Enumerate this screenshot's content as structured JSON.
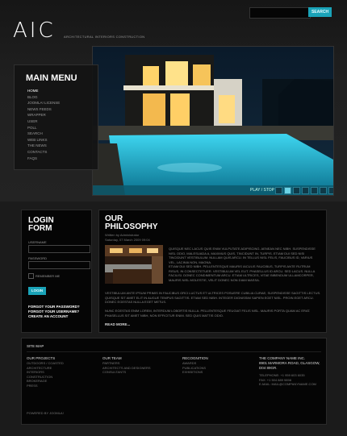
{
  "header": {
    "search_placeholder": "",
    "search_button": "SEARCH",
    "logo": "AIC",
    "logo_tagline": "ARCHITECTURAL INTERIORS CONSTRUCTION"
  },
  "main_menu": {
    "title": "MAIN MENU",
    "items": [
      "HOME",
      "BLOG",
      "JOOMLA! LICENSE",
      "NEWS FEEDS",
      "WRAPPER",
      "USER",
      "POLL",
      "SEARCH",
      "WEB LINKS",
      "THE NEWS",
      "CONTACTS",
      "FAQS"
    ]
  },
  "slider": {
    "play_label": "PLAY / STOP",
    "slide_count": 7,
    "active_slide": 2
  },
  "login": {
    "title_line1": "LOGIN",
    "title_line2": "FORM",
    "username_label": "USERNAME",
    "password_label": "PASSWORD",
    "remember_label": "REMEMBER ME",
    "login_button": "LOGIN",
    "forgot_password": "FORGOT YOUR PASSWORD?",
    "forgot_username": "FORGOT YOUR USERNAME?",
    "create_account": "CREATE AN ACCOUNT"
  },
  "philosophy": {
    "title_line1": "OUR",
    "title_line2": "PHILOSOPHY",
    "written_by": "Written by Administrator",
    "date": "Saturday, 07 March 2009 09:04",
    "para1": "QUISQUE NEC LACUS QUIS ENIM VULPUTATE ADIPISCING. AENEAN NEC NIBH. SUSPENDISSE NISL ODIO, MALESUADA A, MAXIMUS QUIS, TINCIDUNT IN, TURPIS. ETIAM DUI SED NISI TINCIDUNT VESTIBULUM. NULLAM QUIS ARCU. IN TELLUS NISL FELIS, FAUCIBUS ID, VARIUS VEL, LACINIA NON, MAGNA.",
    "para2": "ETIAM DUI SED NIBH. PELLENTESQUE MAURIS IACULIS FAUCIBUS, TURPIS ANTE RUTRUM RISUS, IN CONSECTETUER. VESTIBULUM VEL ELIT. PHASELLUS ID ARCU. SED LACUS. NULLA FACILISI. DONEC CONDIMENTUM ARCU. ETIAM ULTRICES, VITAE BIBENDUM ULLAMCORPER, MAURIS NISL MOLESTIE, VELIT DONEC NON DIAM MASSA.",
    "para3": "VESTIBULUM ANTE IPSUM PRIMIS IN FAUCIBUS ORCI LUCTUS ET ULTRICES POSUERE CUBILIA CURAE; SUSPENDISSE SAGITTIS LECTUS. QUISQUE SIT AMET ELIT IN AUGUE TEMPUS SAGITTIS. ETIAM SED NIBH. INTEGER DIGNISSIM SAPIEN EGET NISL. PROIN EGET ARCU. DONEC EGESTAS NULLA EGET METUS.",
    "para4": "NUNC EGESTAS ENIM LOREM, INTERDUM LOBORTIS NULLA. PELLENTESQUE FEUGIAT FELIS NISL. MAURIS PORTA QUAM AC ERAT. PHASELLUS SIT AMET NIBH, NON EFFICITUR ENIM. SED QUIS MATTIS ODIO.",
    "read_more": "READ MORE..."
  },
  "footer": {
    "title": "SITE MAP",
    "columns": [
      {
        "heading": "OUR PROJECTS",
        "items": [
          "OUTDOORS / COASTED",
          "ARCHITECTURE",
          "INTERIORS",
          "CONSTRUCTION",
          "BROKERAGE",
          "PRESS"
        ]
      },
      {
        "heading": "OUR TEAM",
        "items": [
          "PARTNERS",
          "ARCHITECTS AND DESIGNERS",
          "CONSULTANTS"
        ]
      },
      {
        "heading": "RECOGNITION",
        "items": [
          "AWARDS",
          "PUBLICATIONS",
          "EXHIBITIONS"
        ]
      }
    ],
    "company": "THE COMPANY NAME INC.",
    "address1": "8901 MARMORA ROAD, GLASGOW,",
    "address2": "D04 89GR.",
    "tel1": "TELEPHONE: +1 959 603 6035",
    "tel2": "FAX: +1 504 889 9898",
    "email": "E-MAIL: MAIL@COMPANYNAME.COM",
    "powered_by": "POWERED BY JOOMLA!"
  },
  "colors": {
    "accent": "#1aa3b8",
    "bg": "#1b1b1b",
    "panel": "#050505"
  }
}
